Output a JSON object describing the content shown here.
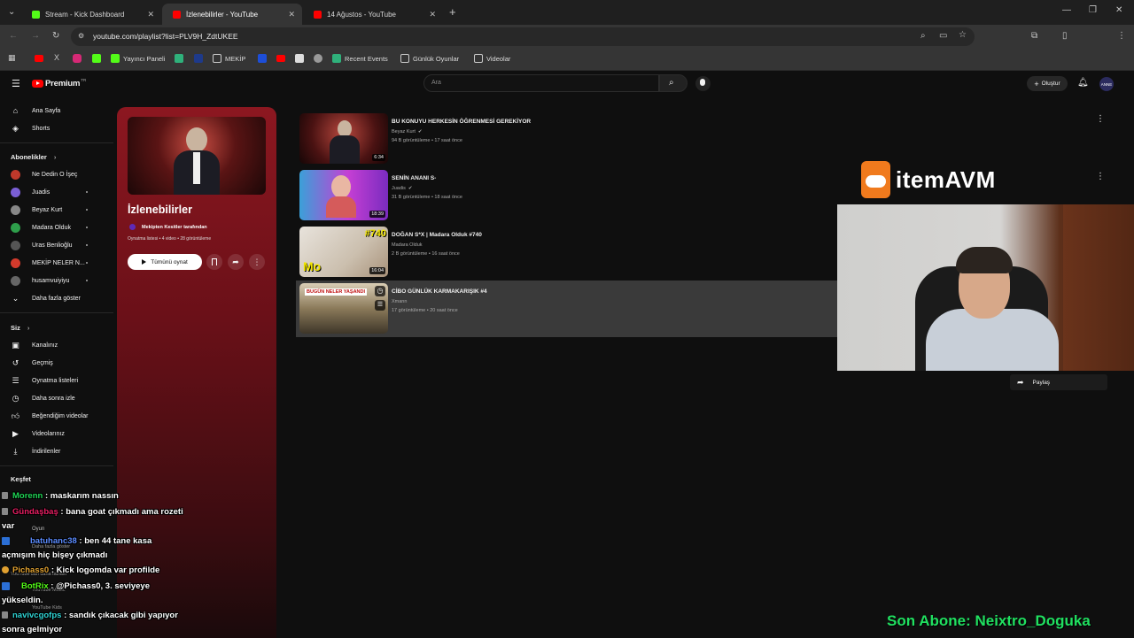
{
  "browser": {
    "tabs": [
      {
        "title": "Stream - Kick Dashboard",
        "color": "#53fc18"
      },
      {
        "title": "İzlenebilirler - YouTube",
        "color": "#ff0000"
      },
      {
        "title": "14 Ağustos - YouTube",
        "color": "#ff0000"
      }
    ],
    "url": "youtube.com/playlist?list=PLV9H_ZdtUKEE",
    "bookmarks": [
      "Yayıncı Paneli",
      "MEKİP",
      "Recent Events",
      "Günlük Oyunlar",
      "Videolar"
    ]
  },
  "youtube": {
    "logo": "Premium",
    "logo_sup": "TR",
    "search_placeholder": "Ara",
    "create_label": "Oluştur",
    "avatar_text": "ANNE",
    "sidebar": {
      "main": [
        {
          "label": "Ana Sayfa",
          "icon": "home-icon"
        },
        {
          "label": "Shorts",
          "icon": "shorts-icon"
        }
      ],
      "subscriptions_title": "Abonelikler",
      "subscriptions": [
        {
          "label": "Ne Dedin O İşeç",
          "color": "#c0392b"
        },
        {
          "label": "Juadis",
          "color": "#7b5fd6"
        },
        {
          "label": "Beyaz Kurt",
          "color": "#888888"
        },
        {
          "label": "Madara Olduk",
          "color": "#2e9e4b"
        },
        {
          "label": "Uras Benlioğlu",
          "color": "#555555"
        },
        {
          "label": "MEKİP NELER N...",
          "color": "#d33a2c"
        },
        {
          "label": "husamvuiyiyu",
          "color": "#666666"
        }
      ],
      "show_more": "Daha fazla göster",
      "you_title": "Siz",
      "you": [
        {
          "label": "Kanalınız",
          "icon": "channel-icon"
        },
        {
          "label": "Geçmiş",
          "icon": "history-icon"
        },
        {
          "label": "Oynatma listeleri",
          "icon": "playlists-icon"
        },
        {
          "label": "Daha sonra izle",
          "icon": "watch-later-icon"
        },
        {
          "label": "Beğendiğim videolar",
          "icon": "like-icon"
        },
        {
          "label": "Videolarınız",
          "icon": "your-videos-icon"
        },
        {
          "label": "İndirilenler",
          "icon": "download-icon"
        }
      ],
      "explore_title": "Keşfet",
      "explore_faded": [
        "Oyun",
        "Daha fazla göster",
        "YouTube'dan daha fazlası",
        "YouTube Music",
        "YouTube Kids"
      ]
    },
    "playlist": {
      "title": "İzlenebilirler",
      "owner": "Mekipten Kesitler tarafından",
      "meta": "Oynatma listesi • 4 video • 28 görüntüleme",
      "play_all": "Tümünü oynat"
    },
    "videos": [
      {
        "title": "BU KONUYU HERKESİN ÖĞRENMESİ GEREKİYOR",
        "channel": "Beyaz Kurt",
        "verified": true,
        "meta": "94 B görüntüleme • 17 saat önce",
        "duration": "6:34"
      },
      {
        "title": "SENİN ANANI S-",
        "channel": "Juadis",
        "verified": true,
        "meta": "31 B görüntüleme • 18 saat önce",
        "duration": "18:39"
      },
      {
        "title": "DOĞAN S*X | Madara Olduk #740",
        "channel": "Madara Olduk",
        "verified": false,
        "meta": "2 B görüntüleme • 16 saat önce",
        "duration": "16:04",
        "thumb_text": "#740",
        "thumb_logo": "Mo"
      },
      {
        "title": "CİBO GÜNLÜK KARMAKARIŞIK #4",
        "channel": "Xmann",
        "verified": false,
        "meta": "17 görüntüleme • 20 saat önce",
        "thumb_text": "BUGÜN NELER YAŞANDI"
      }
    ],
    "share_label": "Paylaş"
  },
  "overlay": {
    "brand": "itemAVM",
    "chat": [
      {
        "user": "Morenn",
        "text": " : maskarım nassın",
        "color": "#1fd655"
      },
      {
        "user": "Gündaşbaş",
        "text": " : bana goat çıkmadı ama rozeti",
        "color": "#e91e63"
      },
      {
        "user": "",
        "text": "var",
        "color": "#ffffff"
      },
      {
        "user": "batuhanc38",
        "text": " : ben 44 tane kasa",
        "color": "#5b8cff"
      },
      {
        "user": "",
        "text": "açmışım hiç bişey çıkmadı",
        "color": "#ffffff"
      },
      {
        "user": "Pichass0",
        "text": " : Kick logomda var profilde",
        "color": "#e0a030"
      },
      {
        "user": "BotRix",
        "text": " : @Pichass0, 3. seviyeye",
        "color": "#53fc18"
      },
      {
        "user": "",
        "text": "yükseldin.",
        "color": "#ffffff"
      },
      {
        "user": "navivcgofps",
        "text": " : sandık çıkacak gibi yapıyor",
        "color": "#2fd3d3"
      },
      {
        "user": "",
        "text": "sonra gelmiyor",
        "color": "#ffffff"
      }
    ],
    "sub_notice": "Son Abone: Neixtro_Doguka"
  }
}
